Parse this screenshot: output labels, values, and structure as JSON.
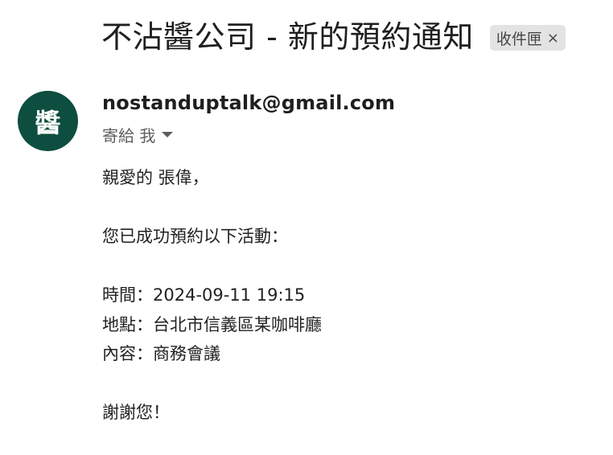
{
  "email": {
    "subject": "不沾醬公司 - 新的預約通知",
    "label": "收件匣",
    "label_close": "×",
    "avatar_text": "醬",
    "sender": "nostanduptalk@gmail.com",
    "recipient": "寄給 我",
    "body": {
      "greeting": "親愛的 張偉，",
      "intro": "您已成功預約以下活動：",
      "time": "時間：2024-09-11 19:15",
      "location": "地點：台北市信義區某咖啡廳",
      "content": "內容：商務會議",
      "closing": "謝謝您！"
    }
  },
  "colors": {
    "avatar_bg": "#0d4e40",
    "chip_bg": "#e3e3e3"
  }
}
